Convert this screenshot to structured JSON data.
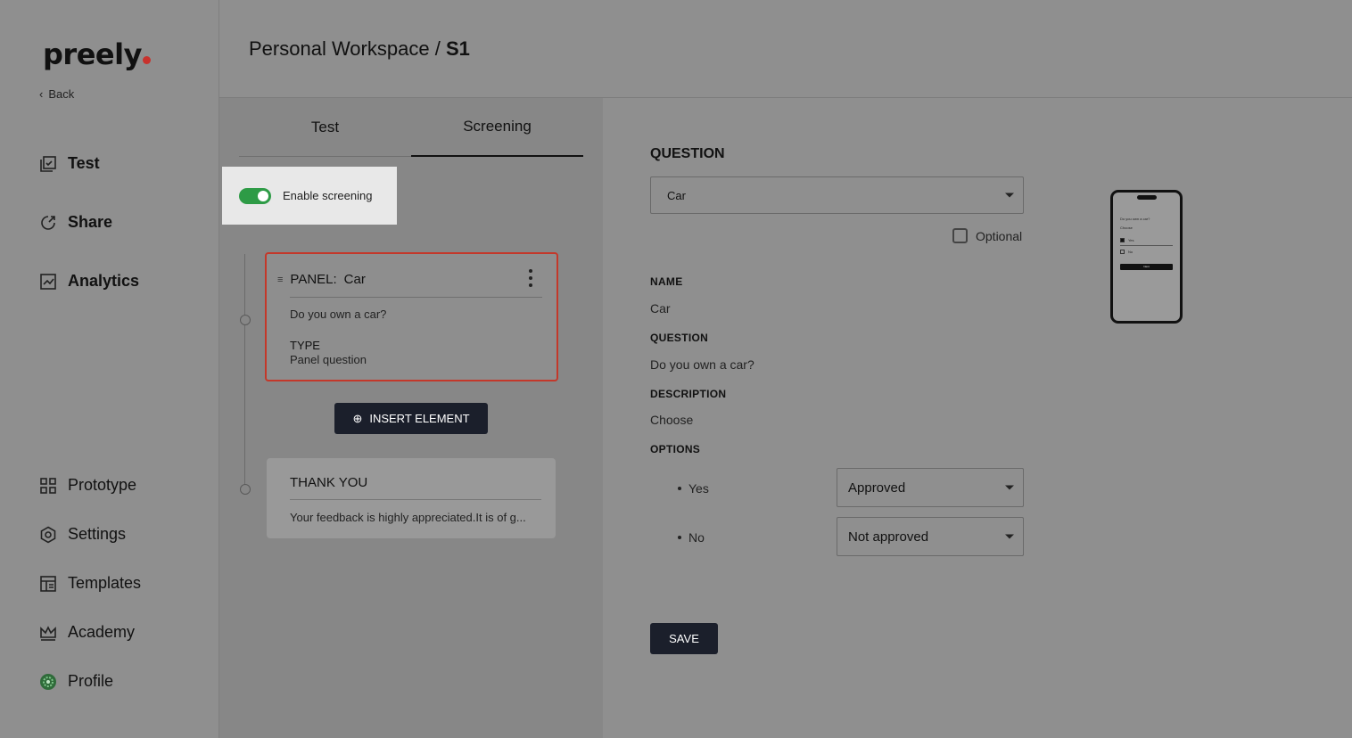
{
  "brand": {
    "logo_text": "preely"
  },
  "sidebar": {
    "back_label": "Back",
    "top_items": [
      {
        "label": "Test",
        "icon": "test-icon"
      },
      {
        "label": "Share",
        "icon": "share-icon"
      },
      {
        "label": "Analytics",
        "icon": "analytics-icon"
      }
    ],
    "bottom_items": [
      {
        "label": "Prototype",
        "icon": "grid-icon"
      },
      {
        "label": "Settings",
        "icon": "gear-icon"
      },
      {
        "label": "Templates",
        "icon": "templates-icon"
      },
      {
        "label": "Academy",
        "icon": "crown-icon"
      },
      {
        "label": "Profile",
        "icon": "avatar-icon"
      }
    ]
  },
  "header": {
    "breadcrumb_root": "Personal Workspace",
    "breadcrumb_sep": "/",
    "breadcrumb_current": "S1"
  },
  "tabs": [
    {
      "label": "Test",
      "active": false
    },
    {
      "label": "Screening",
      "active": true
    }
  ],
  "screening": {
    "toggle_label": "Enable screening",
    "enabled": true
  },
  "panel_card": {
    "prefix": "PANEL:",
    "name": "Car",
    "question": "Do you own a car?",
    "type_label": "TYPE",
    "type_value": "Panel question"
  },
  "insert_button": "INSERT ELEMENT",
  "thanks_card": {
    "title": "THANK YOU",
    "text": "Your feedback is highly appreciated.It is of g..."
  },
  "editor": {
    "section_title": "QUESTION",
    "question_select": "Car",
    "optional_label": "Optional",
    "optional_checked": false,
    "name_label": "NAME",
    "name_value": "Car",
    "question_label": "QUESTION",
    "question_value": "Do you own a car?",
    "description_label": "DESCRIPTION",
    "description_value": "Choose",
    "options_label": "OPTIONS",
    "options": [
      {
        "label": "Yes",
        "status": "Approved"
      },
      {
        "label": "No",
        "status": "Not approved"
      }
    ],
    "save_label": "SAVE"
  },
  "preview": {
    "question": "Do you own a car?",
    "description": "Choose",
    "options": [
      "Yes",
      "No"
    ],
    "button": "Next"
  },
  "colors": {
    "toggle_on": "#2e9b46",
    "panel_border": "#c3382a",
    "button_dark": "#1b1f2b",
    "logo_dot": "#c8322d"
  }
}
